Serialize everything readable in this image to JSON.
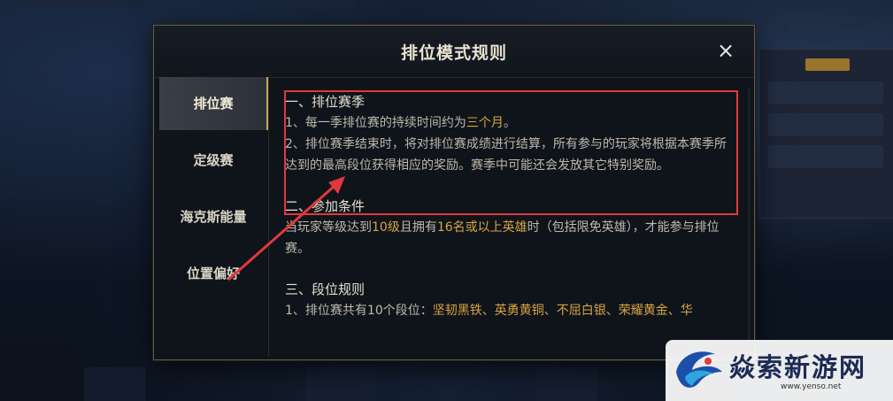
{
  "modal": {
    "title": "排位模式规则",
    "close_label": "×"
  },
  "sidebar": {
    "items": [
      {
        "label": "排位赛",
        "active": true
      },
      {
        "label": "定级赛",
        "active": false
      },
      {
        "label": "海克斯能量",
        "active": false
      },
      {
        "label": "位置偏好",
        "active": false
      }
    ]
  },
  "content": {
    "section1": {
      "title": "一、排位赛季",
      "line1_prefix": "1、每一季排位赛的持续时间约为",
      "line1_highlight": "三个月",
      "line1_suffix": "。",
      "line2": "2、排位赛季结束时，将对排位赛成绩进行结算，所有参与的玩家将根据本赛季所达到的最高段位获得相应的奖励。赛季中可能还会发放其它特别奖励。"
    },
    "section2": {
      "title": "二、参加条件",
      "text_a": "当玩家等级达到",
      "highlight_a": "10级",
      "text_b": "且拥有",
      "highlight_b": "16名或以上英雄",
      "text_c": "时（包括限免英雄），才能参与排位赛。"
    },
    "section3": {
      "title": "三、段位规则",
      "text_a": "1、排位赛共有10个段位：",
      "highlight_a": "坚韧黑铁、英勇黄铜、不屈白银、荣耀黄金、华"
    }
  },
  "watermark": {
    "brand": "焱索新游网",
    "url": "www.yenso.net"
  },
  "colors": {
    "highlight_gold": "#d9a43e",
    "annotation_red": "#e0393d",
    "active_tab_accent": "#c9a45a"
  }
}
